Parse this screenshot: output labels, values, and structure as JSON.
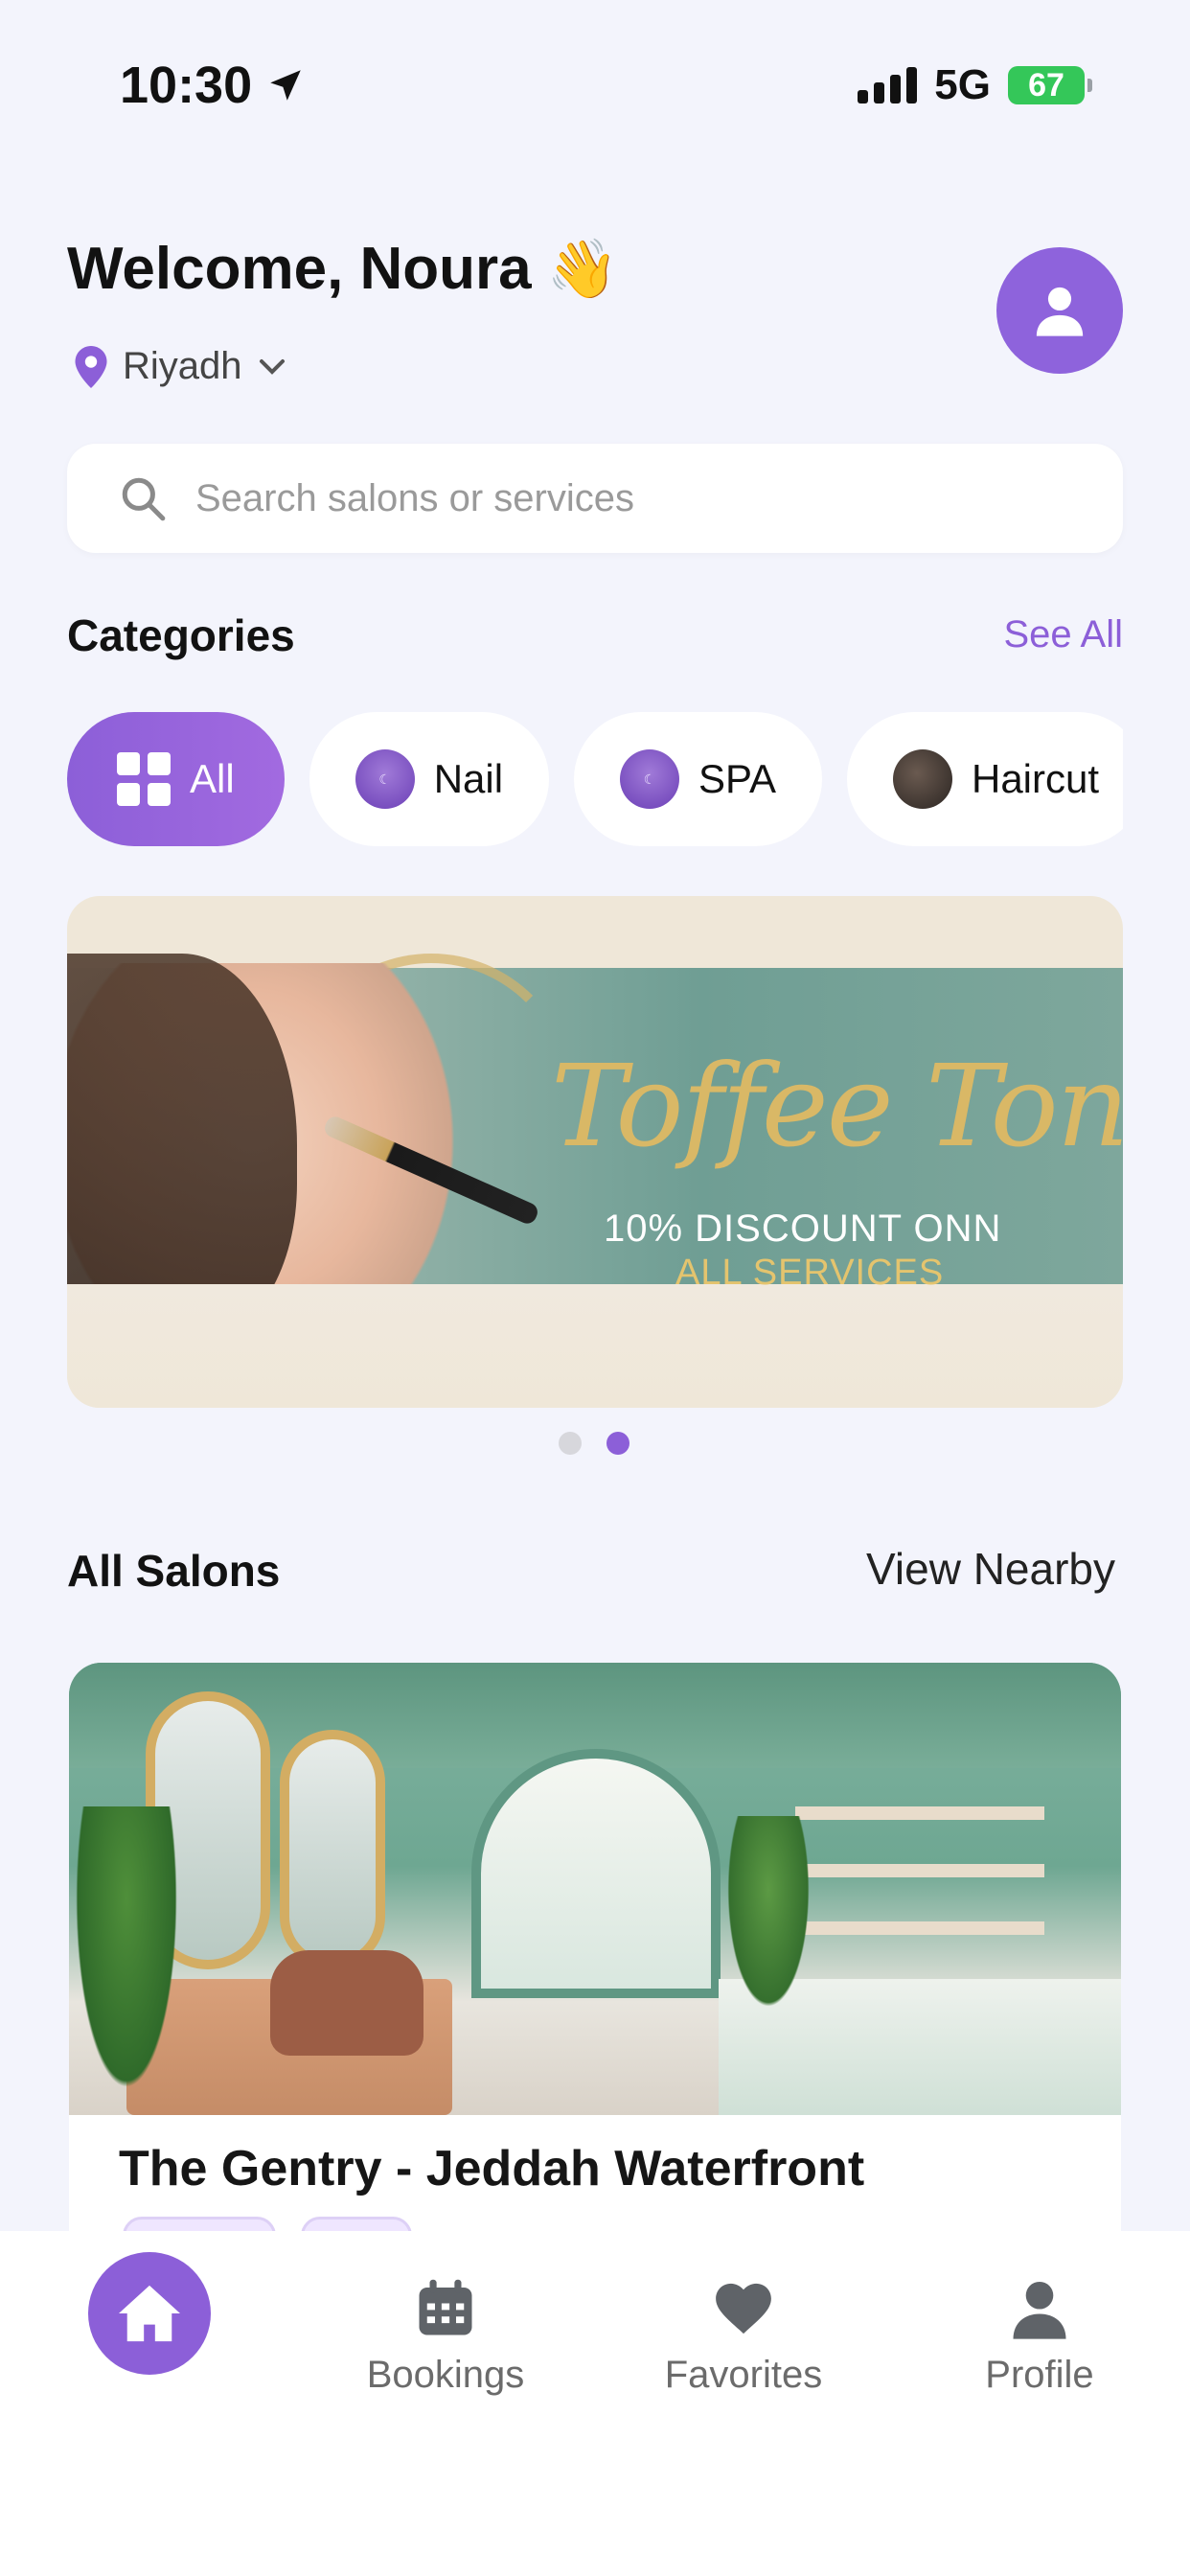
{
  "status_bar": {
    "time": "10:30",
    "network": "5G",
    "battery": "67"
  },
  "header": {
    "welcome": "Welcome, Noura",
    "wave_emoji": "👋",
    "location": "Riyadh",
    "icons": [
      "location-pin-icon",
      "chevron-down-icon",
      "user-icon"
    ]
  },
  "search": {
    "placeholder": "Search salons or services"
  },
  "categories": {
    "title": "Categories",
    "see_all": "See All",
    "chips": [
      {
        "label": "All",
        "icon": "grid-icon",
        "active": true
      },
      {
        "label": "Nail",
        "icon": "brand-logo"
      },
      {
        "label": "SPA",
        "icon": "brand-logo"
      },
      {
        "label": "Haircut",
        "icon": "photo-thumbnail"
      }
    ]
  },
  "banner": {
    "title": "Toffee Tones",
    "line1": "10% DISCOUNT ONN",
    "line2": "ALL SERVICES",
    "page_count": 2,
    "active_page": 2
  },
  "salons": {
    "title": "All Salons",
    "view_nearby": "View Nearby",
    "items": [
      {
        "name": "The Gentry - Jeddah Waterfront"
      }
    ]
  },
  "bottom_nav": {
    "items": [
      {
        "label": "Home",
        "icon": "home-icon",
        "active": true
      },
      {
        "label": "Bookings",
        "icon": "calendar-icon"
      },
      {
        "label": "Favorites",
        "icon": "heart-icon"
      },
      {
        "label": "Profile",
        "icon": "user-icon"
      }
    ]
  },
  "colors": {
    "accent": "#8c5fd8",
    "background": "#f3f4fc",
    "battery": "#34c759",
    "banner_gold": "#d9b866"
  }
}
